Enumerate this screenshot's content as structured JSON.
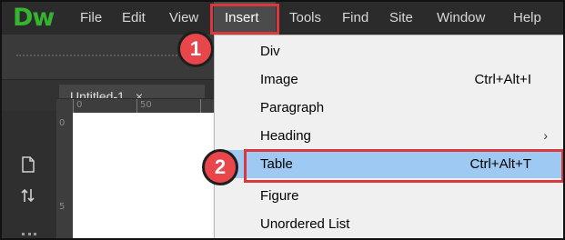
{
  "app": {
    "logo_text": "Dw",
    "brand_color": "#35b52f"
  },
  "menubar": {
    "items": [
      {
        "label": "File"
      },
      {
        "label": "Edit"
      },
      {
        "label": "View"
      },
      {
        "label": "Insert"
      },
      {
        "label": "Tools"
      },
      {
        "label": "Find"
      },
      {
        "label": "Site"
      },
      {
        "label": "Window"
      },
      {
        "label": "Help"
      }
    ],
    "active_item": "Insert"
  },
  "document": {
    "tab_title": "Untitled-1",
    "close_glyph": "×",
    "ruler_h_labels": [
      "0",
      "50"
    ],
    "ruler_v_labels": [
      "0",
      "5"
    ]
  },
  "insert_menu": {
    "items": [
      {
        "label": "Div",
        "shortcut": ""
      },
      {
        "label": "Image",
        "shortcut": "Ctrl+Alt+I"
      },
      {
        "label": "Paragraph",
        "shortcut": ""
      },
      {
        "label": "Heading",
        "shortcut": "",
        "submenu_arrow": "›"
      },
      {
        "label": "Table",
        "shortcut": "Ctrl+Alt+T"
      },
      {
        "label": "Figure",
        "shortcut": ""
      },
      {
        "label": "Unordered List",
        "shortcut": ""
      }
    ],
    "highlighted_item": "Table",
    "highlight_color": "#9ec9f2"
  },
  "callouts": {
    "step1": "1",
    "step2": "2",
    "color": "#d9393d"
  },
  "left_panel": {
    "icons": [
      "file-icon",
      "upload-download-icon"
    ]
  }
}
